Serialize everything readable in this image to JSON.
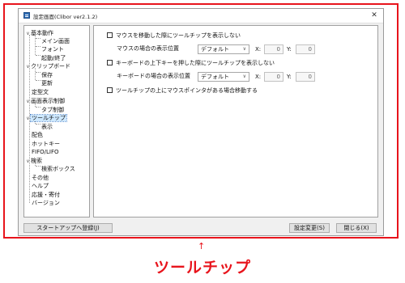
{
  "window": {
    "title": "設定画面(Clibor ver2.1.2)",
    "close_glyph": "✕"
  },
  "tree": {
    "items": [
      {
        "label": "基本動作",
        "toggle": "∨"
      },
      {
        "label": "メイン画面"
      },
      {
        "label": "フォント"
      },
      {
        "label": "起動/終了"
      },
      {
        "label": "クリップボード",
        "toggle": "∨"
      },
      {
        "label": "保存"
      },
      {
        "label": "更新"
      },
      {
        "label": "定型文"
      },
      {
        "label": "画面表示制御",
        "toggle": "∨"
      },
      {
        "label": "タブ制御"
      },
      {
        "label": "ツールチップ",
        "toggle": "∨",
        "selected": true
      },
      {
        "label": "表示"
      },
      {
        "label": "配色"
      },
      {
        "label": "ホットキー"
      },
      {
        "label": "FIFO/LIFO"
      },
      {
        "label": "検索",
        "toggle": "∨"
      },
      {
        "label": "検索ボックス"
      },
      {
        "label": "その他"
      },
      {
        "label": "ヘルプ"
      },
      {
        "label": "応援・寄付"
      },
      {
        "label": "バージョン"
      }
    ]
  },
  "panel": {
    "mouse_tooltip_checkbox": "マウスを移動した際にツールチップを表示しない",
    "mouse_position_label": "マウスの場合の表示位置",
    "mouse_position_select": "デフォルト",
    "keyboard_tooltip_checkbox": "キーボードの上下キーを押した際にツールチップを表示しない",
    "keyboard_position_label": "キーボードの場合の表示位置",
    "keyboard_position_select": "デフォルト",
    "move_on_hover_checkbox": "ツールチップの上にマウスポインタがある場合移動する",
    "x_label": "X:",
    "y_label": "Y:",
    "mouse_x": "0",
    "mouse_y": "0",
    "keyboard_x": "0",
    "keyboard_y": "0",
    "chevron": "∨"
  },
  "footer": {
    "startup_button": "スタートアップへ登録(J)",
    "apply_button": "設定変更(S)",
    "close_button": "閉じる(X)"
  },
  "annotation": {
    "arrow": "↑",
    "caption": "ツールチップ",
    "color": "#e8141c"
  }
}
